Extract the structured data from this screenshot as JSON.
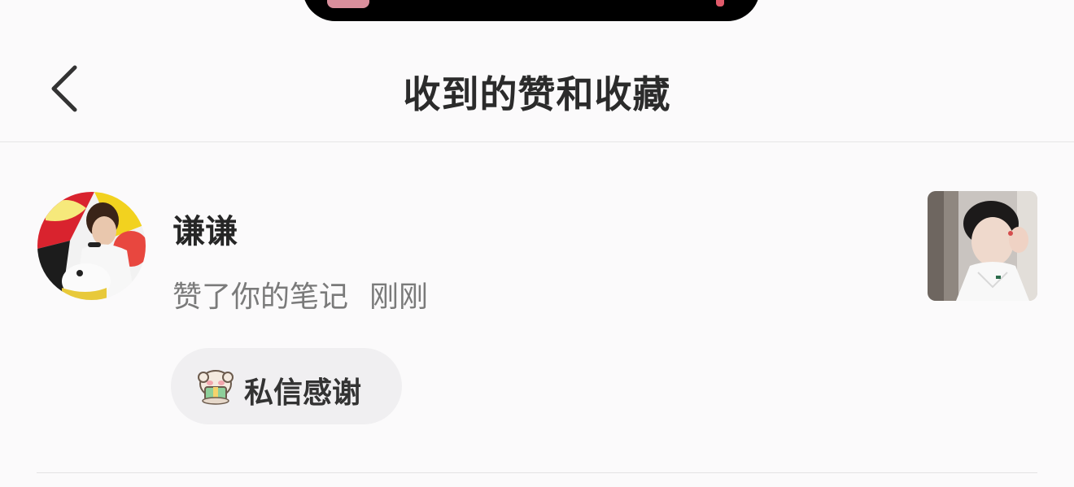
{
  "header": {
    "title": "收到的赞和收藏"
  },
  "notification": {
    "username": "谦谦",
    "action": "赞了你的笔记",
    "time": "刚刚",
    "thank_button_label": "私信感谢"
  },
  "icons": {
    "back": "chevron-left-icon",
    "thank": "sheep-emoji-icon"
  },
  "colors": {
    "background": "#fbfafb",
    "title_text": "#2b2b2b",
    "secondary_text": "#7a7a7a",
    "pill_background": "#f0eff1"
  }
}
